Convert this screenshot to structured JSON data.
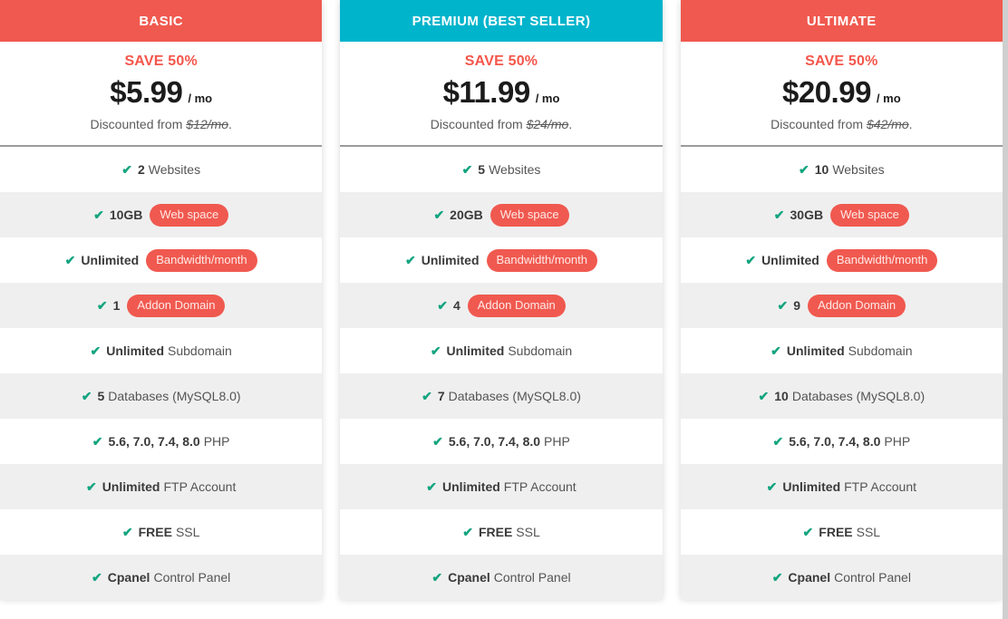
{
  "theme": {
    "accent_red": "#f0594f",
    "accent_teal": "#00b4cc",
    "save_text_color": "#f4564b",
    "check_color": "#12a47f",
    "alt_row_bg": "#efefef"
  },
  "icons": {
    "check": "✔"
  },
  "plans": [
    {
      "id": "basic",
      "name": "BASIC",
      "header_color": "#f0594f",
      "save_label": "SAVE 50%",
      "price": "$5.99",
      "period": "/ mo",
      "discount_prefix": "Discounted from ",
      "discount_old_price": "$12/mo",
      "discount_suffix": ".",
      "features": [
        {
          "strong": "2",
          "rest": "Websites",
          "badge": ""
        },
        {
          "strong": "10GB",
          "rest": "",
          "badge": "Web space"
        },
        {
          "strong": "Unlimited",
          "rest": "",
          "badge": "Bandwidth/month"
        },
        {
          "strong": "1",
          "rest": "",
          "badge": "Addon Domain"
        },
        {
          "strong": "Unlimited",
          "rest": "Subdomain",
          "badge": ""
        },
        {
          "strong": "5",
          "rest": "Databases (MySQL8.0)",
          "badge": ""
        },
        {
          "strong": "5.6, 7.0, 7.4, 8.0",
          "rest": "PHP",
          "badge": ""
        },
        {
          "strong": "Unlimited",
          "rest": "FTP Account",
          "badge": ""
        },
        {
          "strong": "FREE",
          "rest": "SSL",
          "badge": ""
        },
        {
          "strong": "Cpanel",
          "rest": "Control Panel",
          "badge": ""
        }
      ]
    },
    {
      "id": "premium",
      "name": "PREMIUM (BEST SELLER)",
      "header_color": "#00b4cc",
      "save_label": "SAVE 50%",
      "price": "$11.99",
      "period": "/ mo",
      "discount_prefix": "Discounted from ",
      "discount_old_price": "$24/mo",
      "discount_suffix": ".",
      "features": [
        {
          "strong": "5",
          "rest": "Websites",
          "badge": ""
        },
        {
          "strong": "20GB",
          "rest": "",
          "badge": "Web space"
        },
        {
          "strong": "Unlimited",
          "rest": "",
          "badge": "Bandwidth/month"
        },
        {
          "strong": "4",
          "rest": "",
          "badge": "Addon Domain"
        },
        {
          "strong": "Unlimited",
          "rest": "Subdomain",
          "badge": ""
        },
        {
          "strong": "7",
          "rest": "Databases (MySQL8.0)",
          "badge": ""
        },
        {
          "strong": "5.6, 7.0, 7.4, 8.0",
          "rest": "PHP",
          "badge": ""
        },
        {
          "strong": "Unlimited",
          "rest": "FTP Account",
          "badge": ""
        },
        {
          "strong": "FREE",
          "rest": "SSL",
          "badge": ""
        },
        {
          "strong": "Cpanel",
          "rest": "Control Panel",
          "badge": ""
        }
      ]
    },
    {
      "id": "ultimate",
      "name": "ULTIMATE",
      "header_color": "#f0594f",
      "save_label": "SAVE 50%",
      "price": "$20.99",
      "period": "/ mo",
      "discount_prefix": "Discounted from ",
      "discount_old_price": "$42/mo",
      "discount_suffix": ".",
      "features": [
        {
          "strong": "10",
          "rest": "Websites",
          "badge": ""
        },
        {
          "strong": "30GB",
          "rest": "",
          "badge": "Web space"
        },
        {
          "strong": "Unlimited",
          "rest": "",
          "badge": "Bandwidth/month"
        },
        {
          "strong": "9",
          "rest": "",
          "badge": "Addon Domain"
        },
        {
          "strong": "Unlimited",
          "rest": "Subdomain",
          "badge": ""
        },
        {
          "strong": "10",
          "rest": "Databases (MySQL8.0)",
          "badge": ""
        },
        {
          "strong": "5.6, 7.0, 7.4, 8.0",
          "rest": "PHP",
          "badge": ""
        },
        {
          "strong": "Unlimited",
          "rest": "FTP Account",
          "badge": ""
        },
        {
          "strong": "FREE",
          "rest": "SSL",
          "badge": ""
        },
        {
          "strong": "Cpanel",
          "rest": "Control Panel",
          "badge": ""
        }
      ]
    }
  ]
}
